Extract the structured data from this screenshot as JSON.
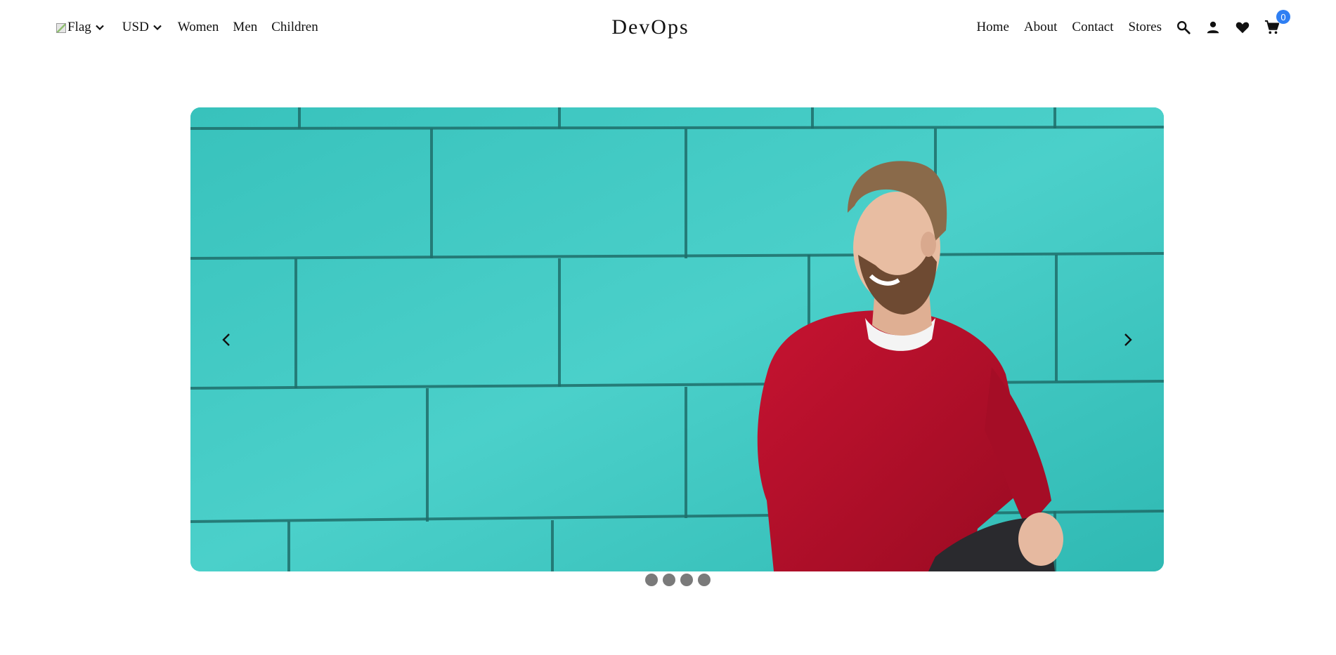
{
  "header": {
    "flag_alt": "Flag",
    "currency": "USD",
    "categories": [
      "Women",
      "Men",
      "Children"
    ],
    "brand": "DevOps",
    "nav_links": [
      "Home",
      "About",
      "Contact",
      "Stores"
    ],
    "icons": [
      "search-icon",
      "user-icon",
      "heart-icon",
      "cart-icon"
    ],
    "cart_count": "0",
    "badge_color": "#2f7ff3"
  },
  "hero": {
    "image_subject": "smiling man in red sweater against turquoise brick wall",
    "slide_count": 4,
    "wall_color": "#3cc8c2",
    "sweater_color": "#b8102a"
  }
}
